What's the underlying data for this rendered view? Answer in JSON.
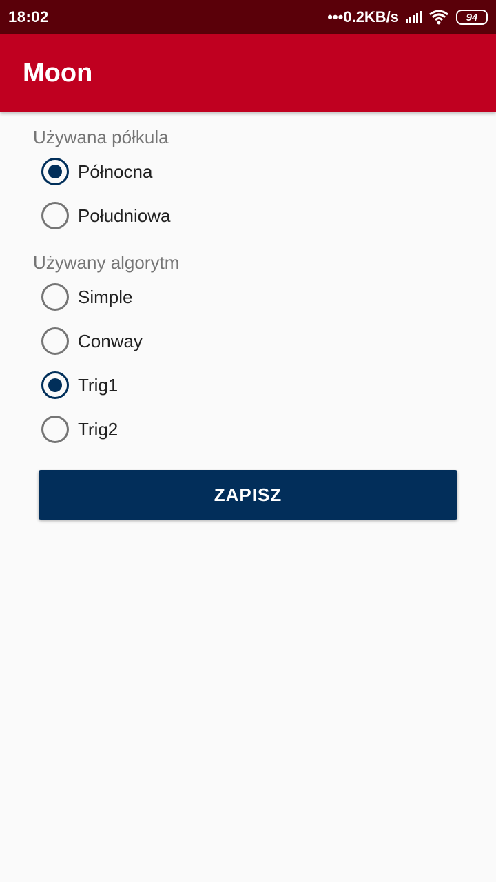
{
  "status_bar": {
    "time": "18:02",
    "network_speed": "•••0.2KB/s",
    "battery": "94",
    "icons": [
      "signal-icon",
      "wifi-icon",
      "battery-icon"
    ]
  },
  "app_bar": {
    "title": "Moon"
  },
  "hemisphere": {
    "label": "Używana półkula",
    "options": [
      {
        "label": "Północna",
        "checked": true
      },
      {
        "label": "Południowa",
        "checked": false
      }
    ]
  },
  "algorithm": {
    "label": "Używany algorytm",
    "options": [
      {
        "label": "Simple",
        "checked": false
      },
      {
        "label": "Conway",
        "checked": false
      },
      {
        "label": "Trig1",
        "checked": true
      },
      {
        "label": "Trig2",
        "checked": false
      }
    ]
  },
  "save_button": {
    "label": "ZAPISZ"
  },
  "colors": {
    "status_bar": "#5a0009",
    "app_bar": "#c00020",
    "accent": "#012f5a",
    "background": "#fafafa"
  }
}
